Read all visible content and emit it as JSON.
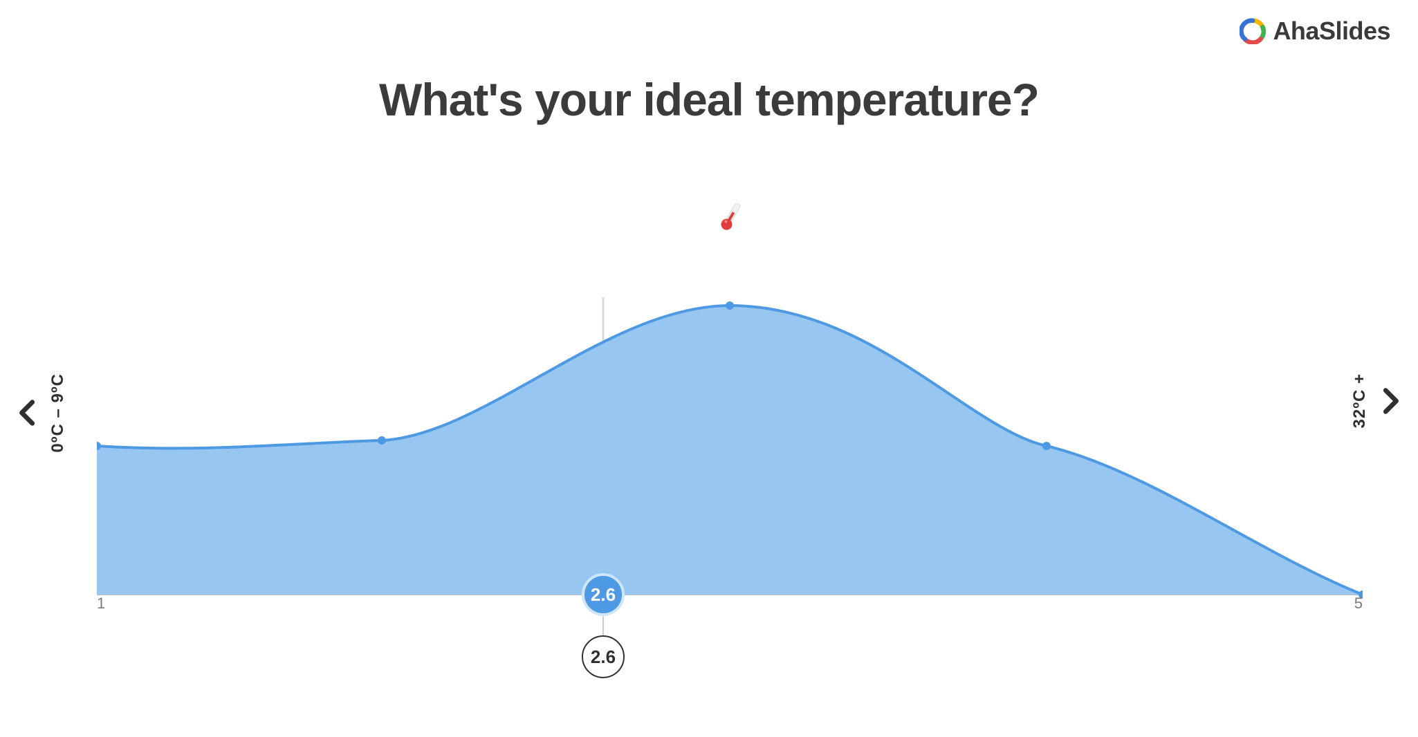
{
  "brand": {
    "name": "AhaSlides"
  },
  "title": "What's your ideal temperature?",
  "axis": {
    "min_tick": "1",
    "max_tick": "5",
    "left_extreme_label": "0ºC – 9ºC",
    "right_extreme_label": "32ºC +"
  },
  "mean_value_label_top": "2.6",
  "mean_value_label_bottom": "2.6",
  "icon_name": "thermometer-icon",
  "chart_data": {
    "type": "area",
    "title": "What's your ideal temperature?",
    "xlabel": "",
    "ylabel": "",
    "x_range": [
      1,
      5
    ],
    "x": [
      1.0,
      1.9,
      3.0,
      4.0,
      5.0
    ],
    "values": [
      0.5,
      0.52,
      1.0,
      0.5,
      0.0
    ],
    "mean": 2.6,
    "fill_color": "#97c7f0",
    "stroke_color": "#4e99e3",
    "x_extreme_labels": {
      "min": "0ºC – 9ºC",
      "max": "32ºC +"
    },
    "note": "values are relative heights (1.0 = peak of curve)"
  }
}
